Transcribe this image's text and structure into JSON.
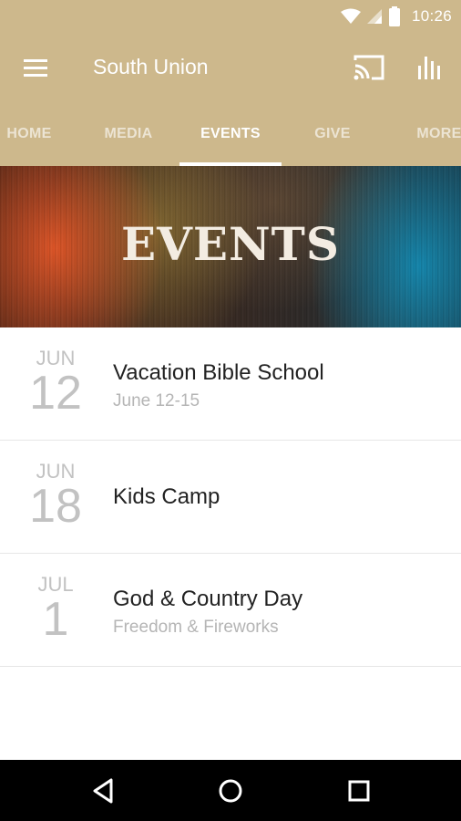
{
  "status_bar": {
    "time": "10:26",
    "icons": [
      "wifi-icon",
      "signal-icon",
      "battery-icon"
    ]
  },
  "app_bar": {
    "title": "South Union",
    "icons": [
      "menu-icon",
      "cast-icon",
      "bar-chart-icon"
    ]
  },
  "tabs": [
    {
      "label": "HOME",
      "active": false
    },
    {
      "label": "MEDIA",
      "active": false
    },
    {
      "label": "EVENTS",
      "active": true
    },
    {
      "label": "GIVE",
      "active": false
    },
    {
      "label": "MORE",
      "active": false
    }
  ],
  "hero": {
    "title": "EVENTS"
  },
  "events": [
    {
      "month": "JUN",
      "day": "12",
      "title": "Vacation Bible School",
      "subtitle": "June 12-15"
    },
    {
      "month": "JUN",
      "day": "18",
      "title": "Kids Camp",
      "subtitle": ""
    },
    {
      "month": "JUL",
      "day": "1",
      "title": "God & Country Day",
      "subtitle": "Freedom & Fireworks"
    }
  ],
  "colors": {
    "primary": "#cdb88c",
    "date_text": "#c2c2c2",
    "title_text": "#222222",
    "subtitle_text": "#b5b5b5",
    "nav_bar": "#000000"
  },
  "nav_bar": {
    "icons": [
      "back-icon",
      "home-icon",
      "recents-icon"
    ]
  }
}
